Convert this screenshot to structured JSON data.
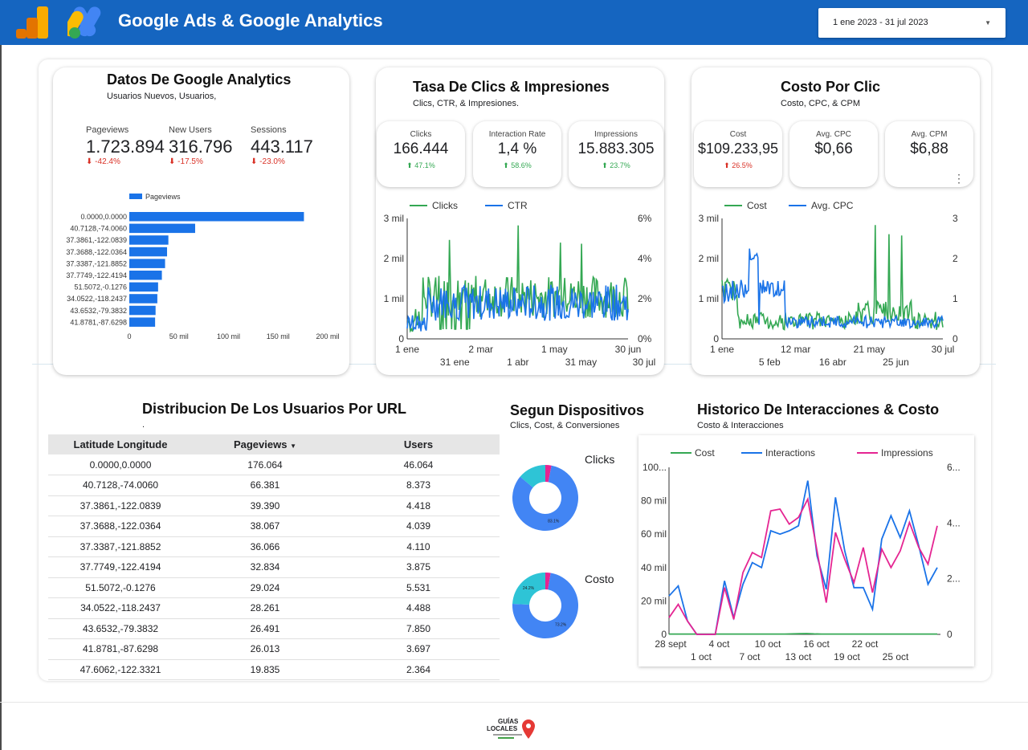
{
  "header": {
    "title": "Google Ads & Google Analytics",
    "date_range": "1 ene 2023 - 31 jul 2023",
    "brand_color": "#1565c0"
  },
  "ga_card": {
    "title": "Datos De Google Analytics",
    "subtitle": "Usuarios Nuevos, Usuarios,",
    "kpis": [
      {
        "label": "Pageviews",
        "value": "1.723.894",
        "delta": "-42.4%"
      },
      {
        "label": "New Users",
        "value": "316.796",
        "delta": "-17.5%"
      },
      {
        "label": "Sessions",
        "value": "443.117",
        "delta": "-23.0%"
      }
    ],
    "bar_chart": {
      "type": "bar",
      "orientation": "horizontal",
      "legend": "Pageviews",
      "color": "#1a73e8",
      "categories": [
        "0.0000,0.0000",
        "40.7128,-74.0060",
        "37.3861,-122.0839",
        "37.3688,-122.0364",
        "37.3387,-121.8852",
        "37.7749,-122.4194",
        "51.5072,-0.1276",
        "34.0522,-118.2437",
        "43.6532,-79.3832",
        "41.8781,-87.6298"
      ],
      "values": [
        176064,
        66381,
        39390,
        38067,
        36066,
        32834,
        29024,
        28261,
        26491,
        26013
      ],
      "x_ticks": [
        "0",
        "50 mil",
        "100 mil",
        "150 mil",
        "200 mil"
      ],
      "xlim": [
        0,
        200000
      ]
    }
  },
  "ctr_card": {
    "title": "Tasa De Clics & Impresiones",
    "subtitle": "Clics, CTR, & Impresiones.",
    "scorecards": [
      {
        "label": "Clicks",
        "value": "166.444",
        "delta": "47.1%",
        "trend": "up"
      },
      {
        "label": "Interaction Rate",
        "value": "1,4 %",
        "delta": "58.6%",
        "trend": "up"
      },
      {
        "label": "Impressions",
        "value": "15.883.305",
        "delta": "23.7%",
        "trend": "up"
      }
    ],
    "chart": {
      "type": "line",
      "series": [
        {
          "name": "Clicks",
          "color": "#34a853"
        },
        {
          "name": "CTR",
          "color": "#1a73e8"
        }
      ],
      "y_left_ticks": [
        "3 mil",
        "2 mil",
        "1 mil",
        "0"
      ],
      "y_right_ticks": [
        "6%",
        "4%",
        "2%",
        "0%"
      ],
      "x_ticks_top": [
        "1 ene",
        "2 mar",
        "1 may",
        "30 jun"
      ],
      "x_ticks_bottom": [
        "31 ene",
        "1 abr",
        "31 may",
        "30 jul"
      ]
    }
  },
  "cpc_card": {
    "title": "Costo Por Clic",
    "subtitle": "Costo, CPC, & CPM",
    "scorecards": [
      {
        "label": "Cost",
        "value": "$109.233,95",
        "delta": "26.5%",
        "trend": "up-red"
      },
      {
        "label": "Avg. CPC",
        "value": "$0,66",
        "delta": "",
        "trend": ""
      },
      {
        "label": "Avg. CPM",
        "value": "$6,88",
        "delta": "",
        "trend": ""
      }
    ],
    "chart": {
      "type": "line",
      "series": [
        {
          "name": "Cost",
          "color": "#34a853"
        },
        {
          "name": "Avg. CPC",
          "color": "#1a73e8"
        }
      ],
      "y_left_ticks": [
        "3 mil",
        "2 mil",
        "1 mil",
        "0"
      ],
      "y_right_ticks": [
        "3",
        "2",
        "1",
        "0"
      ],
      "x_ticks_top": [
        "1 ene",
        "12 mar",
        "21 may",
        "30 jul"
      ],
      "x_ticks_bottom": [
        "5 feb",
        "16 abr",
        "25 jun"
      ]
    }
  },
  "distribution": {
    "title": "Distribucion De Los Usuarios Por URL",
    "note": ".",
    "columns": [
      "Latitude Longitude",
      "Pageviews",
      "Users"
    ],
    "sort_icon": "caret-down-icon",
    "rows": [
      [
        "0.0000,0.0000",
        "176.064",
        "46.064"
      ],
      [
        "40.7128,-74.0060",
        "66.381",
        "8.373"
      ],
      [
        "37.3861,-122.0839",
        "39.390",
        "4.418"
      ],
      [
        "37.3688,-122.0364",
        "38.067",
        "4.039"
      ],
      [
        "37.3387,-121.8852",
        "36.066",
        "4.110"
      ],
      [
        "37.7749,-122.4194",
        "32.834",
        "3.875"
      ],
      [
        "51.5072,-0.1276",
        "29.024",
        "5.531"
      ],
      [
        "34.0522,-118.2437",
        "28.261",
        "4.488"
      ],
      [
        "43.6532,-79.3832",
        "26.491",
        "7.850"
      ],
      [
        "41.8781,-87.6298",
        "26.013",
        "3.697"
      ],
      [
        "47.6062,-122.3321",
        "19.835",
        "2.364"
      ]
    ]
  },
  "devices": {
    "title": "Segun Dispositivos",
    "subtitle": "Clics, Cost, & Conversiones",
    "donuts": [
      {
        "label": "Clicks",
        "segments": [
          {
            "value": 83.1,
            "color": "#4285f4",
            "label": "83.1%"
          },
          {
            "value": 13.9,
            "color": "#2ec4d6",
            "label": ""
          },
          {
            "value": 3.0,
            "color": "#e52592",
            "label": ""
          }
        ]
      },
      {
        "label": "Costo",
        "segments": [
          {
            "value": 73.2,
            "color": "#4285f4",
            "label": "73.2%"
          },
          {
            "value": 24.2,
            "color": "#2ec4d6",
            "label": "24.2%"
          },
          {
            "value": 2.6,
            "color": "#e52592",
            "label": ""
          }
        ]
      }
    ]
  },
  "history": {
    "title": "Historico De Interacciones & Costo",
    "subtitle": "Costo & Interacciones",
    "chart_data": {
      "type": "line",
      "x_ticks_top": [
        "28 sept",
        "4 oct",
        "10 oct",
        "16 oct",
        "22 oct"
      ],
      "x_ticks_bottom": [
        "1 oct",
        "7 oct",
        "13 oct",
        "19 oct",
        "25 oct"
      ],
      "y_left_ticks": [
        "100...",
        "80 mil",
        "60 mil",
        "40 mil",
        "20 mil",
        "0"
      ],
      "y_right_ticks": [
        "6...",
        "4...",
        "2...",
        "0"
      ],
      "ylim_left": [
        0,
        100000
      ],
      "series": [
        {
          "name": "Cost",
          "color": "#34a853",
          "values": [
            200,
            200,
            200,
            200,
            200,
            200,
            200,
            200,
            200,
            200,
            200,
            200,
            200,
            200,
            200,
            200,
            200,
            300,
            400,
            500,
            300,
            200,
            200,
            200,
            200,
            200,
            200,
            200,
            200,
            200,
            200,
            200,
            200,
            200,
            200,
            200,
            200,
            200
          ]
        },
        {
          "name": "Interactions",
          "color": "#1a73e8",
          "values": [
            23000,
            29000,
            8000,
            0,
            0,
            0,
            32000,
            10000,
            30000,
            43000,
            40000,
            62000,
            60000,
            62000,
            65000,
            92000,
            47000,
            27000,
            82000,
            50000,
            28000,
            28000,
            15000,
            57000,
            71000,
            58000,
            74000,
            53000,
            30000,
            40000
          ]
        },
        {
          "name": "Impressions",
          "color": "#e52592",
          "values": [
            10000,
            18000,
            8000,
            0,
            0,
            0,
            28000,
            9000,
            37000,
            49000,
            46000,
            74000,
            75000,
            66000,
            70000,
            81000,
            50000,
            19000,
            61000,
            45000,
            31000,
            52000,
            25000,
            51000,
            40000,
            50000,
            67000,
            52000,
            42000,
            65000
          ]
        }
      ]
    }
  },
  "footer": {
    "logo_line1": "GUÍAS",
    "logo_line2": "LOCALES",
    "pin_color": "#e53935"
  }
}
